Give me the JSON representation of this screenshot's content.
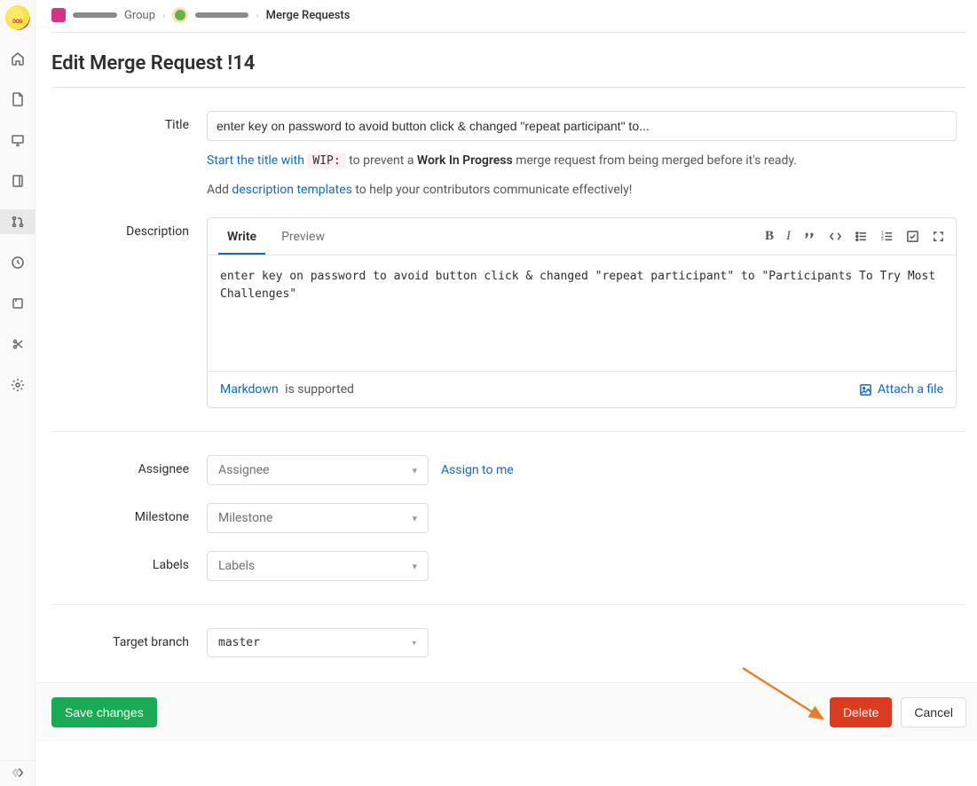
{
  "breadcrumb": {
    "group_text": "Group",
    "final": "Merge Requests"
  },
  "page": {
    "title": "Edit Merge Request !14"
  },
  "form": {
    "title_label": "Title",
    "title_value": "enter key on password to avoid button click & changed \"repeat participant\" to...",
    "wip_hint_prefix": "Start the title with",
    "wip_code": "WIP:",
    "wip_hint_mid": "to prevent a",
    "wip_bold": "Work In Progress",
    "wip_hint_suffix": "merge request from being merged before it's ready.",
    "template_hint_prefix": "Add",
    "template_link": "description templates",
    "template_hint_suffix": "to help your contributors communicate effectively!",
    "description_label": "Description",
    "tabs": {
      "write": "Write",
      "preview": "Preview"
    },
    "description_value": "enter key on password to avoid button click & changed \"repeat participant\" to \"Participants To Try Most Challenges\"",
    "markdown_link": "Markdown",
    "markdown_text": "is supported",
    "attach_text": "Attach a file",
    "assignee_label": "Assignee",
    "assignee_placeholder": "Assignee",
    "assign_to_me": "Assign to me",
    "milestone_label": "Milestone",
    "milestone_placeholder": "Milestone",
    "labels_label": "Labels",
    "labels_placeholder": "Labels",
    "target_branch_label": "Target branch",
    "target_branch_value": "master"
  },
  "actions": {
    "save": "Save changes",
    "delete": "Delete",
    "cancel": "Cancel"
  }
}
